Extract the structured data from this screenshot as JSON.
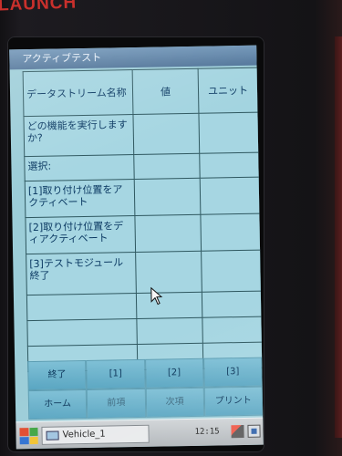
{
  "brand": "LAUNCH",
  "window": {
    "title": "アクティブテスト"
  },
  "table": {
    "headers": {
      "name": "データストリーム名称",
      "value": "値",
      "unit": "ユニット"
    },
    "rows": [
      {
        "name": "どの機能を実行しますか?",
        "value": "",
        "unit": ""
      },
      {
        "name": "選択:",
        "value": "",
        "unit": ""
      },
      {
        "name": "[1]取り付け位置をアクティベート",
        "value": "",
        "unit": ""
      },
      {
        "name": "[2]取り付け位置をディアクティベート",
        "value": "",
        "unit": ""
      },
      {
        "name": "[3]テストモジュール終了",
        "value": "",
        "unit": ""
      },
      {
        "name": "",
        "value": "",
        "unit": ""
      },
      {
        "name": "",
        "value": "",
        "unit": ""
      },
      {
        "name": "",
        "value": "",
        "unit": ""
      }
    ]
  },
  "buttons": {
    "row1": [
      "終了",
      "[1]",
      "[2]",
      "[3]"
    ],
    "row2": [
      "ホーム",
      "前項",
      "次項",
      "プリント"
    ]
  },
  "taskbar": {
    "start_icon": "windows-start-icon",
    "task_label": "Vehicle_1",
    "clock": "12:15"
  },
  "colors": {
    "screen_bg": "#9ccdd8",
    "titlebar": "#5b80a4",
    "text": "#0c3a63",
    "button": "#6bb3cc",
    "brand_red": "#c9302c"
  }
}
